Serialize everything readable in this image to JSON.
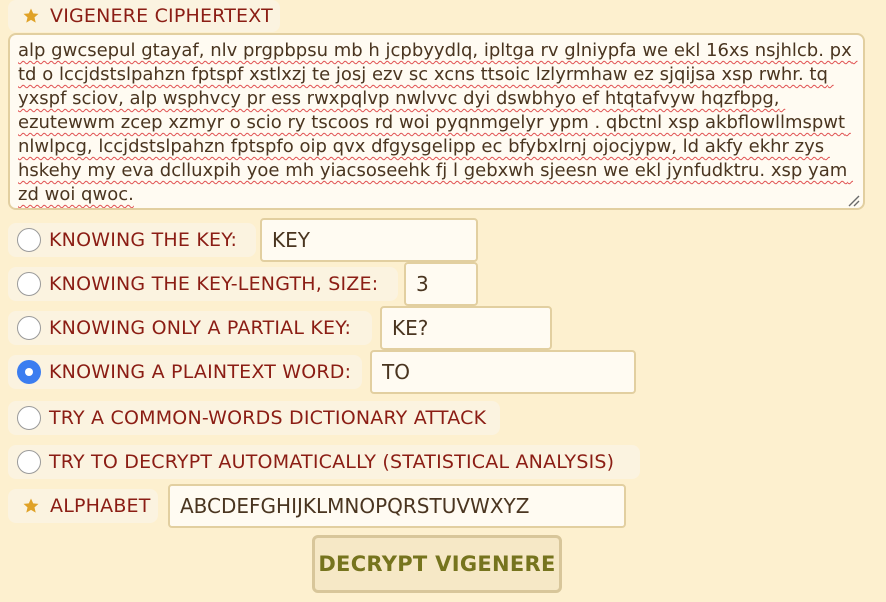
{
  "ciphertext": {
    "label": "VIGENERE CIPHERTEXT",
    "text": "alp gwcsepul gtayaf, nlv prgpbpsu mb h jcpbyydlq, ipltga rv glniypfa we ekl 16xs nsjhlcb. px td o lccjdstslpahzn fptspf xstlxzj te josj ezv sc xcns ttsoic lzlyrmhaw ez sjqijsa xsp rwhr. tq yxspf sciov, alp wsphvcy pr ess rwxpqlvp nwlvvc dyi dswbhyo ef htqtafvyw hqzfbpg, ezutewwm zcep xzmyr o scio ry tscoos rd woi pyqnmgelyr ypm . qbctnl xsp akbflowllmspwt nlwlpcg, lccjdstslpahzn fptspfo oip qvx dfgysgelipp ec bfybxlrnj ojocjypw, ld akfy ekhr zys hskehy my eva dclluxpih yoe mh yiacsoseehk fj l gebxwh sjeesn we ekl jynfudktru. xsp yam zd woi qwoc."
  },
  "options": {
    "key": {
      "label": "KNOWING THE KEY:",
      "value": "KEY"
    },
    "key_length": {
      "label": "KNOWING THE KEY-LENGTH, SIZE:",
      "value": "3"
    },
    "partial_key": {
      "label": "KNOWING ONLY A PARTIAL KEY:",
      "value": "KE?"
    },
    "plaintext_word": {
      "label": "KNOWING A PLAINTEXT WORD:",
      "value": "TO"
    },
    "dictionary": {
      "label": "TRY A COMMON-WORDS DICTIONARY ATTACK"
    },
    "statistical": {
      "label": "TRY TO DECRYPT AUTOMATICALLY (STATISTICAL ANALYSIS)"
    },
    "selected": "plaintext_word"
  },
  "alphabet": {
    "label": "ALPHABET",
    "value": "ABCDEFGHIJKLMNOPQRSTUVWXYZ"
  },
  "decrypt_button": {
    "label": "DECRYPT VIGENERE"
  },
  "colors": {
    "background": "#fdf0cf",
    "label_text": "#8b1d14",
    "radio_selected": "#3b7df0",
    "button_text": "#76741e",
    "star": "#e0a227"
  },
  "icons": {
    "required_marker": "star-icon",
    "resize": "resize-grip-icon"
  }
}
